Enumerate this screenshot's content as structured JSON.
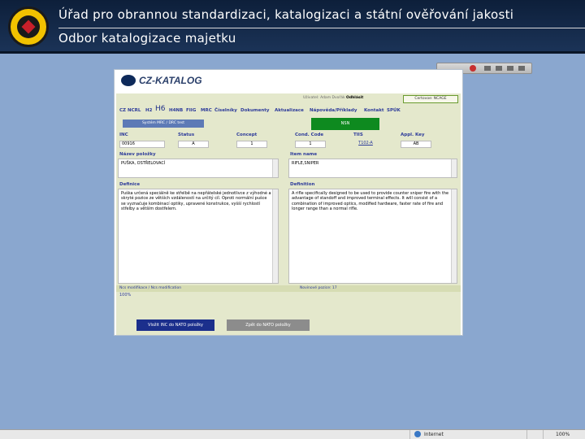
{
  "slide": {
    "title_line1": "Úřad pro obrannou standardizaci, katalogizaci a státní ověřování jakosti",
    "title_line2": "Odbor katalogizace majetku"
  },
  "app": {
    "brand": "CZ-KATALOG",
    "user_label": "Uživatel:",
    "user_name": "Adam Dvořák",
    "logout": "Odhlásit",
    "org_button": "Certovoe: NCAGE",
    "menu": [
      "CZ",
      "NCRL",
      "H2",
      "H6",
      "H4NB",
      "FIIG",
      "MRC",
      "Číselníky",
      "Dokumenty",
      "Aktualizace",
      "Nápověda/Příklady",
      "Kontakt",
      "SPÚK"
    ],
    "mode_button": "Systém MRC / DRC test",
    "nsn_button": "NSN",
    "fields": {
      "inc": {
        "label": "INC",
        "value": "00916"
      },
      "status": {
        "label": "Status",
        "value": "A"
      },
      "concept": {
        "label": "Concept",
        "value": "1"
      },
      "cond_code": {
        "label": "Cond. Code",
        "value": "1"
      },
      "tiis": {
        "label": "TIIS",
        "value": "T102-A"
      },
      "appl_key": {
        "label": "Appl. Key",
        "value": "AB"
      }
    },
    "item_name_cz_label": "Název položky",
    "item_name_cz": "PUŠKA, OSTŘELOVACÍ",
    "item_name_en_label": "Item name",
    "item_name_en": "RIFLE,SNIPER",
    "definition_cz_label": "Definice",
    "definition_cz": "Puška určená speciálně ke střelbě na nepřátelské jednotlivce z výhodné a skryté pozice ze větších vzdáleností na určitý cíl. Oproti normální pušce se vyznačuje kombinací optiky, upravené konstrukce, vyšší rychlostí střelby a větším dostřelem.",
    "definition_en_label": "Definition",
    "definition_en": "A rifle specifically designed to be used to provide counter sniper fire with the advantage of standoff and improved terminal effects. It will consist of a combination of improved optics, modified hardware, faster rate of fire and longer range than a normal rifle.",
    "ncs_modification": "Ncs modifikace / Ncs modification",
    "new_items": "Novinové pozice: 17",
    "percent": "100%",
    "btn_insert": "Vložit INC do NATO položky",
    "btn_back": "Zpět do NATO položky"
  },
  "statusbar": {
    "zone": "Internet",
    "zoom": "100%"
  },
  "colors": {
    "header_bg": "#14294a",
    "desktop_bg": "#8aa7cf",
    "panel_bg": "#e4e8cc",
    "menu_text": "#2d3b9a",
    "nsn_green": "#0e8a1f"
  }
}
